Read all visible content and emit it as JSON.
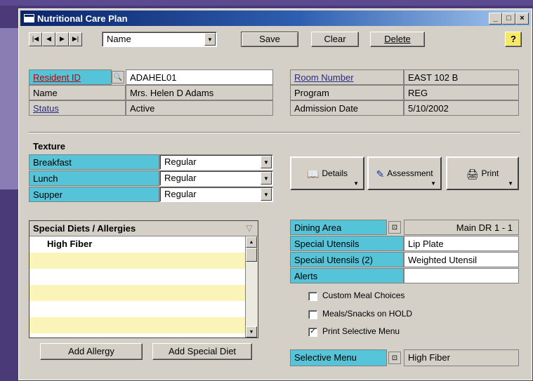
{
  "window": {
    "title": "Nutritional Care Plan",
    "min": "_",
    "max": "□",
    "close": "×"
  },
  "toolbar": {
    "sort_field": "Name",
    "save_label": "Save",
    "clear_label": "Clear",
    "delete_label": "Delete",
    "help_label": "?"
  },
  "resident": {
    "id_label": "Resident ID",
    "id_value": "ADAHEL01",
    "name_label": "Name",
    "name_value": "Mrs. Helen D Adams",
    "status_label": "Status",
    "status_value": "Active"
  },
  "room": {
    "room_label": "Room Number",
    "room_value": "EAST  102  B",
    "program_label": "Program",
    "program_value": "REG",
    "admission_label": "Admission Date",
    "admission_value": "5/10/2002"
  },
  "texture": {
    "title": "Texture",
    "rows": [
      {
        "label": "Breakfast",
        "value": "Regular"
      },
      {
        "label": "Lunch",
        "value": "Regular"
      },
      {
        "label": "Supper",
        "value": "Regular"
      }
    ]
  },
  "actions": {
    "details": "Details",
    "assessment": "Assessment",
    "print": "Print"
  },
  "diets": {
    "title": "Special Diets / Allergies",
    "rows": [
      "High Fiber",
      "",
      "",
      "",
      "",
      ""
    ],
    "add_allergy": "Add Allergy",
    "add_diet": "Add Special Diet"
  },
  "dining": {
    "area_label": "Dining Area",
    "area_value": "Main DR 1 - 1",
    "utensils_label": "Special Utensils",
    "utensils_value": "Lip Plate",
    "utensils2_label": "Special Utensils (2)",
    "utensils2_value": "Weighted Utensil",
    "alerts_label": "Alerts",
    "alerts_value": ""
  },
  "options": [
    {
      "label": "Custom Meal Choices",
      "checked": false,
      "mark": ""
    },
    {
      "label": "Meals/Snacks on HOLD",
      "checked": false,
      "mark": ""
    },
    {
      "label": "Print Selective Menu",
      "checked": true,
      "mark": "✓"
    }
  ],
  "selective_menu": {
    "label": "Selective Menu",
    "value": "High Fiber"
  }
}
